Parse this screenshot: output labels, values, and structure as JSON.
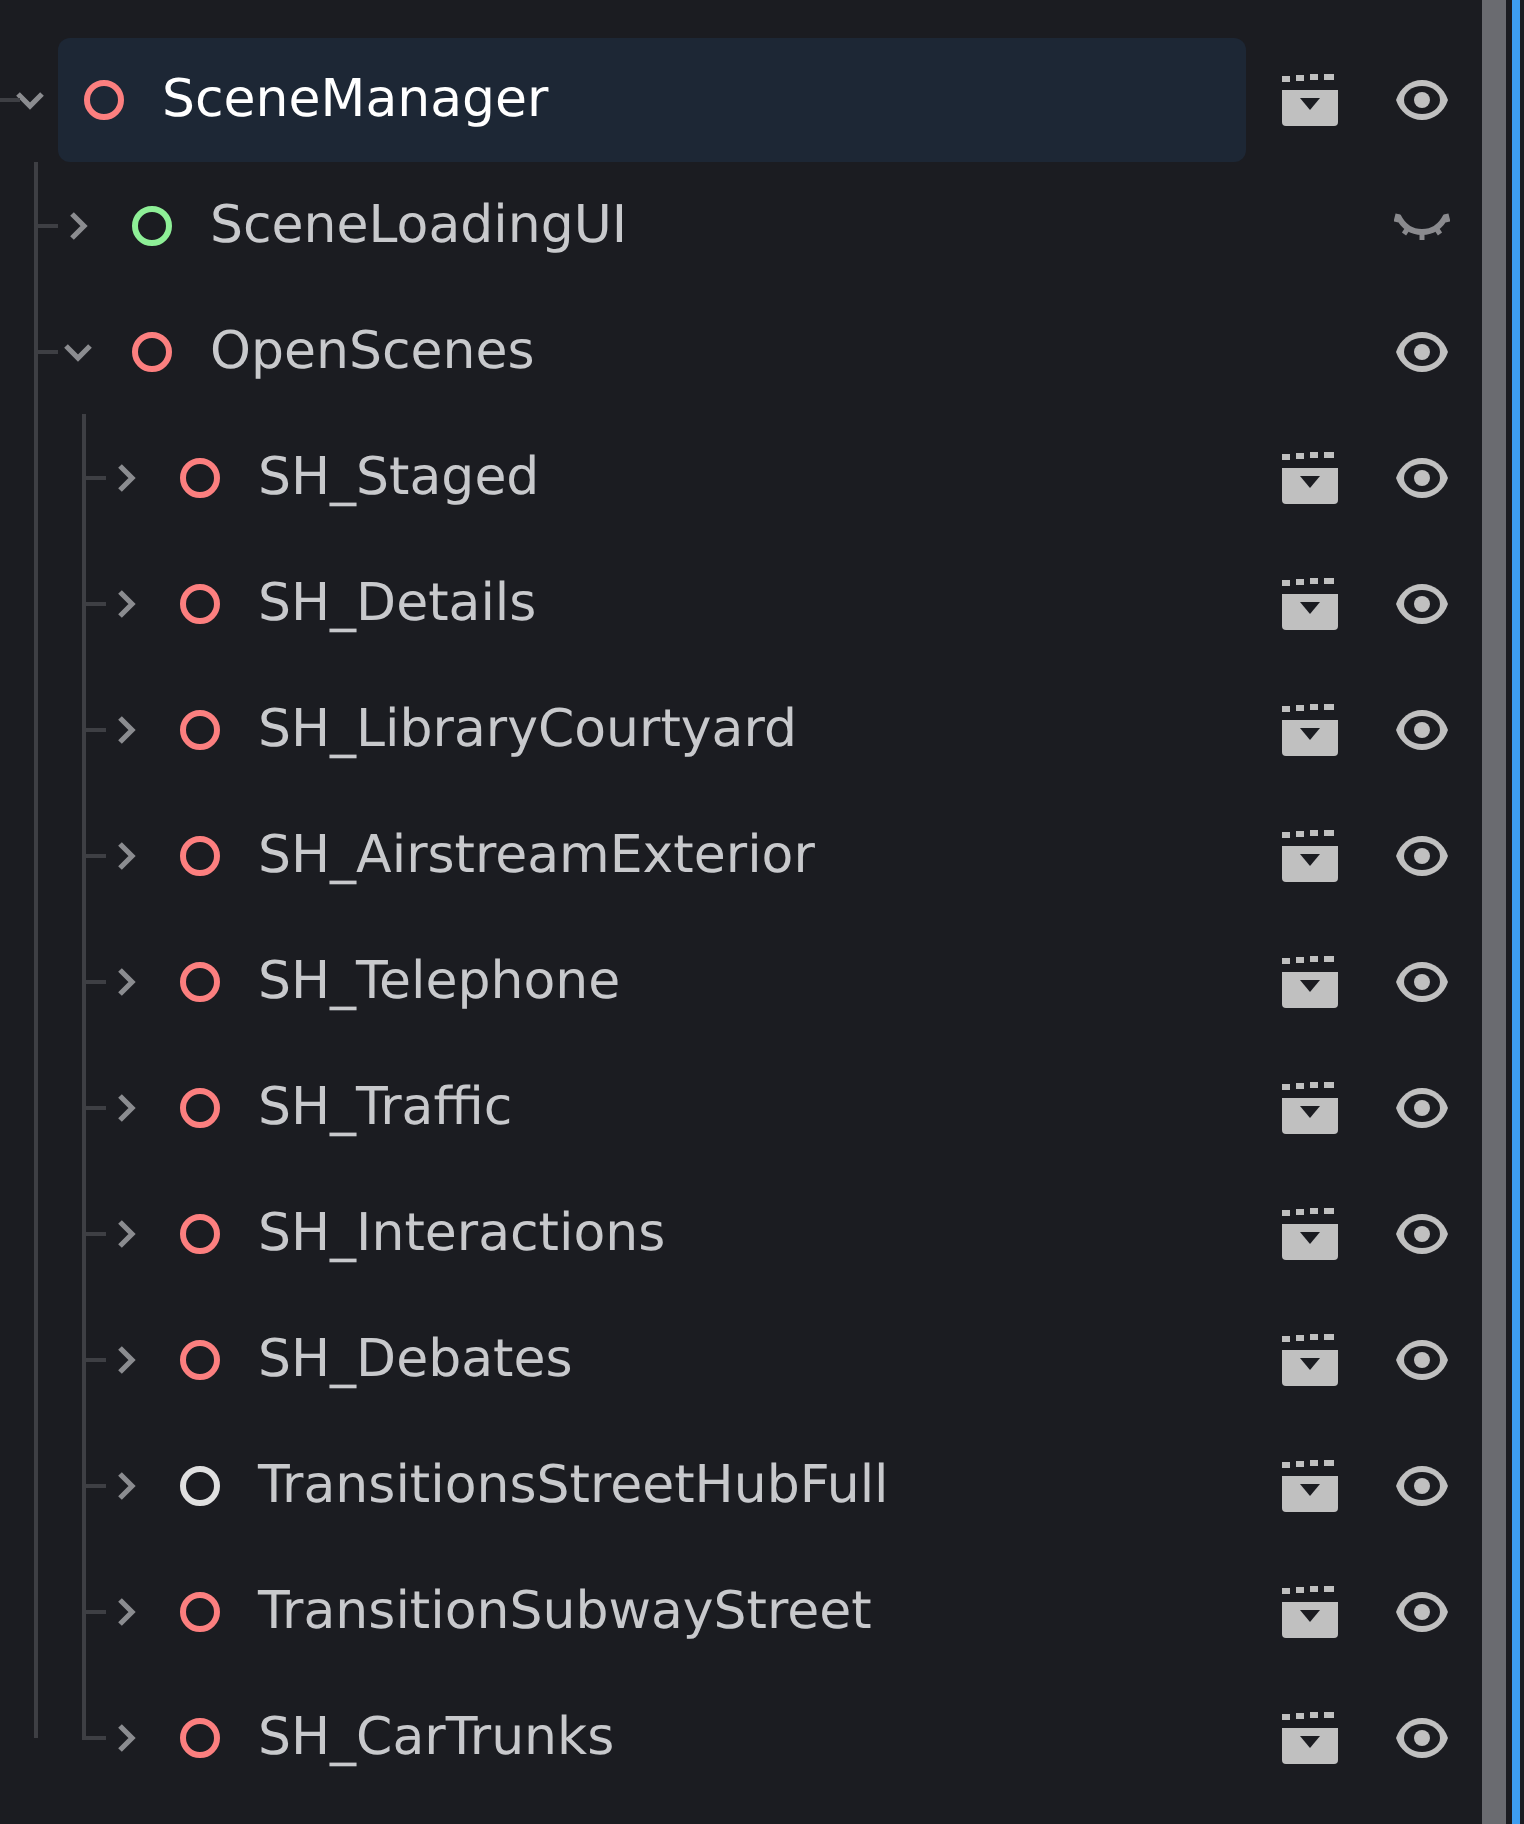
{
  "tree": [
    {
      "name": "SceneManager",
      "color": "#fc7f7f",
      "expanded": true,
      "selected": true,
      "scene": true,
      "visible": true,
      "children": [
        {
          "name": "SceneLoadingUI",
          "color": "#8eef97",
          "expanded": false,
          "selected": false,
          "scene": false,
          "visible": false
        },
        {
          "name": "OpenScenes",
          "color": "#fc7f7f",
          "expanded": true,
          "selected": false,
          "scene": false,
          "visible": true,
          "children": [
            {
              "name": "SH_Staged",
              "color": "#fc7f7f",
              "expanded": false,
              "selected": false,
              "scene": true,
              "visible": true
            },
            {
              "name": "SH_Details",
              "color": "#fc7f7f",
              "expanded": false,
              "selected": false,
              "scene": true,
              "visible": true
            },
            {
              "name": "SH_LibraryCourtyard",
              "color": "#fc7f7f",
              "expanded": false,
              "selected": false,
              "scene": true,
              "visible": true
            },
            {
              "name": "SH_AirstreamExterior",
              "color": "#fc7f7f",
              "expanded": false,
              "selected": false,
              "scene": true,
              "visible": true
            },
            {
              "name": "SH_Telephone",
              "color": "#fc7f7f",
              "expanded": false,
              "selected": false,
              "scene": true,
              "visible": true
            },
            {
              "name": "SH_Traffic",
              "color": "#fc7f7f",
              "expanded": false,
              "selected": false,
              "scene": true,
              "visible": true
            },
            {
              "name": "SH_Interactions",
              "color": "#fc7f7f",
              "expanded": false,
              "selected": false,
              "scene": true,
              "visible": true
            },
            {
              "name": "SH_Debates",
              "color": "#fc7f7f",
              "expanded": false,
              "selected": false,
              "scene": true,
              "visible": true
            },
            {
              "name": "TransitionsStreetHubFull",
              "color": "#e0e0e0",
              "expanded": false,
              "selected": false,
              "scene": true,
              "visible": true
            },
            {
              "name": "TransitionSubwayStreet",
              "color": "#fc7f7f",
              "expanded": false,
              "selected": false,
              "scene": true,
              "visible": true
            },
            {
              "name": "SH_CarTrunks",
              "color": "#fc7f7f",
              "expanded": false,
              "selected": false,
              "scene": true,
              "visible": true
            }
          ]
        }
      ]
    }
  ]
}
